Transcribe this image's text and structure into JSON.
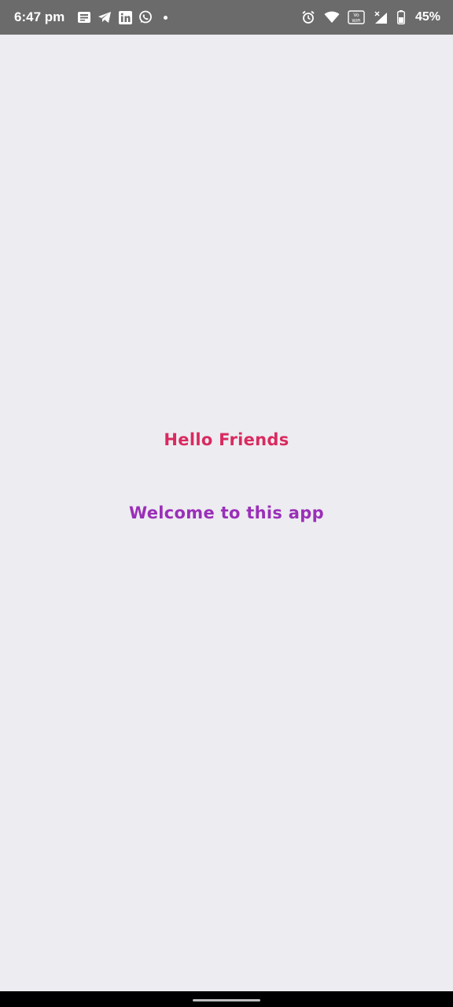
{
  "status_bar": {
    "time": "6:47 pm",
    "battery_percent": "45%",
    "left_icons": [
      "message-icon",
      "telegram-icon",
      "linkedin-icon",
      "whatsapp-icon",
      "more-dot-icon"
    ],
    "right_icons": [
      "alarm-icon",
      "wifi-icon",
      "vowifi-icon",
      "signal-icon",
      "battery-icon"
    ],
    "vowifi_label": "Vo WiFi"
  },
  "main": {
    "hello_text": "Hello Friends",
    "welcome_text": "Welcome to this app"
  },
  "colors": {
    "background": "#edecf1",
    "status_bar": "#6b6b6b",
    "hello_text": "#d92a5f",
    "welcome_text": "#9a2fb8"
  }
}
